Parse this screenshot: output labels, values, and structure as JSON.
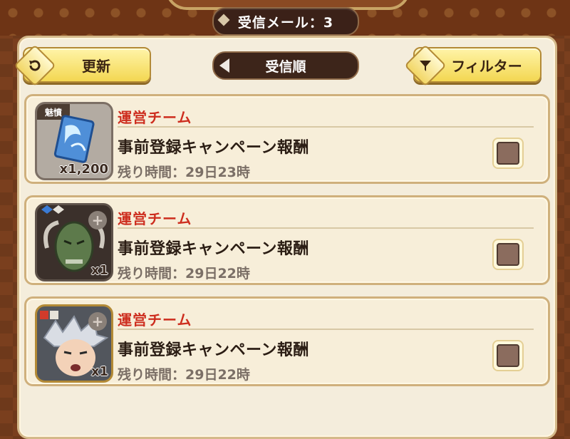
{
  "header": {
    "mail_count": "受信メール：3"
  },
  "toolbar": {
    "refresh_label": "更新",
    "sort_label": "受信順",
    "filter_label": "フィルター"
  },
  "mails": [
    {
      "sender": "運営チーム",
      "subject": "事前登録キャンペーン報酬",
      "remaining": "残り時間：29日23時",
      "item": {
        "tag": "魅憤",
        "quantity": "x1,200",
        "icon": "blue-crystal-icon"
      }
    },
    {
      "sender": "運営チーム",
      "subject": "事前登録キャンペーン報酬",
      "remaining": "残り時間：29日22時",
      "item": {
        "tag": "",
        "quantity": "x1",
        "icon": "green-demon-mask-icon"
      }
    },
    {
      "sender": "運営チーム",
      "subject": "事前登録キャンペーン報酬",
      "remaining": "残り時間：29日22時",
      "item": {
        "tag": "",
        "quantity": "x1",
        "icon": "silver-hair-character-icon"
      }
    }
  ],
  "colors": {
    "sender": "#cd2d1e",
    "button_yellow": "#f3d752",
    "panel": "#f4eddc",
    "background": "#7a3f1e"
  }
}
